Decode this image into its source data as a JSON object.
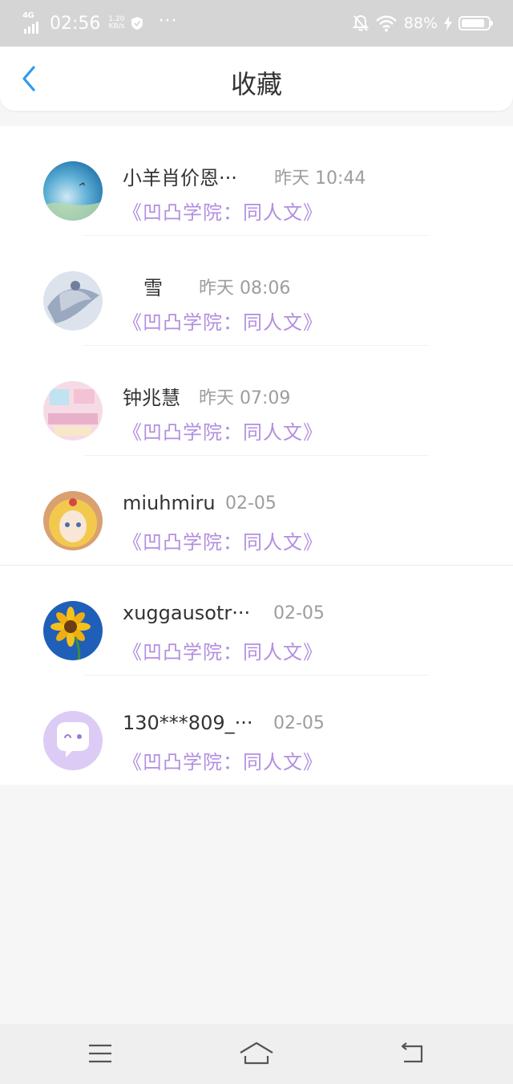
{
  "status_bar": {
    "network": "4G",
    "time": "02:56",
    "speed_value": "1.20",
    "speed_unit": "KB/s",
    "more": "···",
    "battery_pct": "88%",
    "battery_level": 0.88
  },
  "header": {
    "title": "收藏"
  },
  "favorites": [
    {
      "name": "小羊肖价恩···",
      "time": "昨天 10:44",
      "work": "《凹凸学院：同人文》"
    },
    {
      "name": "雪",
      "time": "昨天 08:06",
      "work": "《凹凸学院：同人文》"
    },
    {
      "name": "钟兆慧",
      "time": "昨天 07:09",
      "work": "《凹凸学院：同人文》"
    },
    {
      "name": "miuhmiru",
      "time": "02-05",
      "work": "《凹凸学院：同人文》"
    },
    {
      "name": "xuggausotr···",
      "time": "02-05",
      "work": "《凹凸学院：同人文》"
    },
    {
      "name": "130***809_···",
      "time": "02-05",
      "work": "《凹凸学院：同人文》"
    }
  ],
  "colors": {
    "accent": "#2f9bf0",
    "work_title": "#b28fe0",
    "status_bar_bg": "#d5d5d5"
  },
  "nav": {
    "menu_icon": "menu-icon",
    "home_icon": "home-icon",
    "back_icon": "back-nav-icon"
  }
}
